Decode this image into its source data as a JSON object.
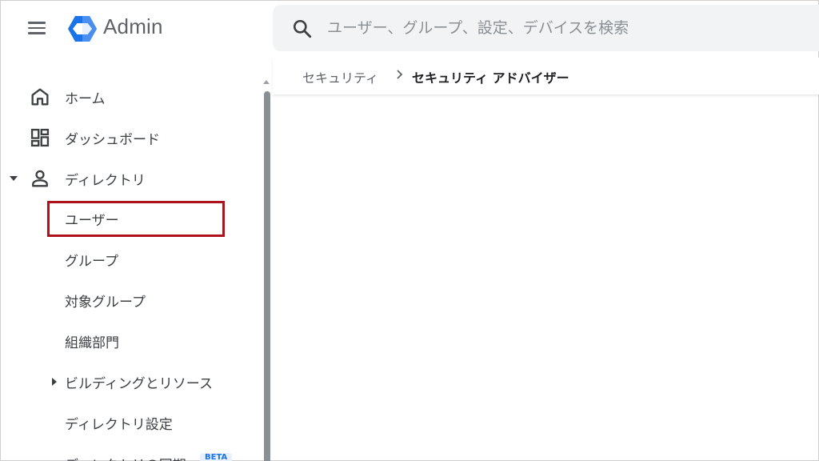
{
  "header": {
    "app_title": "Admin",
    "search_placeholder": "ユーザー、グループ、設定、デバイスを検索"
  },
  "sidebar": {
    "items": [
      {
        "label": "ホーム",
        "icon": "home-icon"
      },
      {
        "label": "ダッシュボード",
        "icon": "dashboard-icon"
      },
      {
        "label": "ディレクトリ",
        "icon": "person-icon",
        "expanded": true
      },
      {
        "label": "ユーザー",
        "highlighted": true
      },
      {
        "label": "グループ"
      },
      {
        "label": "対象グループ"
      },
      {
        "label": "組織部門"
      },
      {
        "label": "ビルディングとリソース",
        "collapsed": true
      },
      {
        "label": "ディレクトリ設定"
      },
      {
        "label": "ディレクトリの同期",
        "badge": "BETA"
      }
    ]
  },
  "breadcrumb": {
    "parent": "セキュリティ",
    "current": "セキュリティ アドバイザー"
  },
  "colors": {
    "highlight": "#b0121c",
    "logo_blue": "#1a73e8",
    "search_bg": "#f1f3f4"
  }
}
